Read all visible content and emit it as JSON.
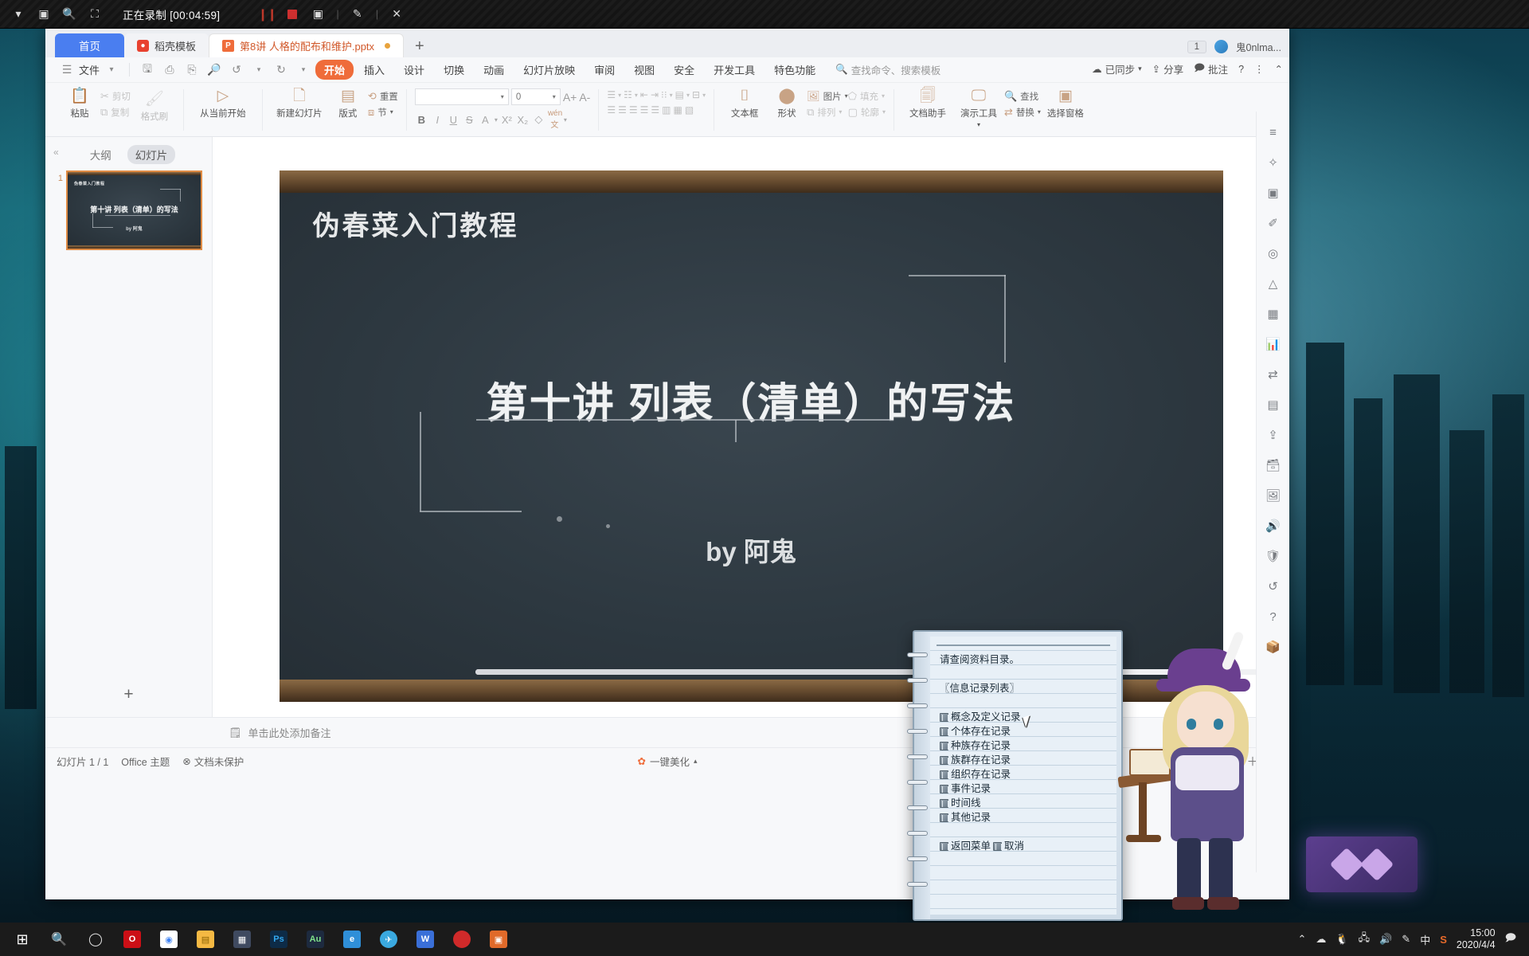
{
  "recording_bar": {
    "status_text": "正在录制 [00:04:59]",
    "icons": [
      "chevron-down-icon",
      "window-icon",
      "zoom-icon",
      "crop-icon"
    ],
    "actions": [
      "pause-icon",
      "stop-icon",
      "camera-icon",
      "pen-icon",
      "close-icon"
    ]
  },
  "window": {
    "tabs": [
      {
        "label": "首页",
        "kind": "home"
      },
      {
        "label": "稻壳模板",
        "kind": "template"
      },
      {
        "label": "第8讲 人格的配布和维护.pptx",
        "kind": "document",
        "modified": true
      }
    ],
    "new_tab_label": "+",
    "tab_count_badge": "1",
    "user_name": "鬼0nlma...",
    "window_controls": {
      "minimize": "—",
      "maximize": "□",
      "close": "×"
    }
  },
  "quickaccess": {
    "file_menu": "文件",
    "icons": [
      "save-icon",
      "print-icon",
      "export-pdf-icon",
      "print-preview-icon",
      "undo-icon",
      "redo-icon",
      "customize-icon"
    ]
  },
  "ribbon": {
    "tabs": [
      "开始",
      "插入",
      "设计",
      "切换",
      "动画",
      "幻灯片放映",
      "审阅",
      "视图",
      "安全",
      "开发工具",
      "特色功能"
    ],
    "selected_tab": "开始",
    "search_placeholder": "查找命令、搜索模板",
    "right_items": [
      {
        "label": "已同步",
        "icon": "cloud-sync-icon"
      },
      {
        "label": "分享",
        "icon": "share-icon"
      },
      {
        "label": "批注",
        "icon": "comment-icon"
      }
    ],
    "right_icons": [
      "help-icon",
      "more-icon",
      "collapse-ribbon-icon"
    ],
    "groups": {
      "clipboard": {
        "paste": "粘贴",
        "cut": "剪切",
        "copy": "复制",
        "format_painter": "格式刷"
      },
      "present": {
        "from_current": "从当前开始"
      },
      "slides": {
        "new_slide": "新建幻灯片",
        "layout": "版式",
        "section": "节",
        "reset": "重置"
      },
      "font": {
        "font_name": "",
        "font_size": "0",
        "grow": "A+",
        "shrink": "A-",
        "bold": "B",
        "italic": "I",
        "underline": "U",
        "strikethrough": "S",
        "font_color": "A",
        "superscript": "X²",
        "subscript": "X₂",
        "clear_format": "clear",
        "phonetic": "wén文"
      },
      "paragraph": {
        "bullets": "bullets-icon",
        "numbering": "numbering-icon",
        "decrease_indent": "decrease-indent-icon",
        "increase_indent": "increase-indent-icon",
        "line_spacing": "line-spacing-icon",
        "text_direction": "text-direction-icon",
        "align_text": "align-text-icon",
        "align_left": "align-left-icon",
        "align_center": "align-center-icon",
        "align_right": "align-right-icon",
        "justify": "justify-icon",
        "distributed": "distributed-icon",
        "columns": "columns-icon",
        "smartart": "smartart-icon"
      },
      "insert": {
        "text_box": "文本框",
        "shape": "形状",
        "picture": "图片",
        "fill": "填充",
        "arrange": "排列",
        "outline": "轮廓"
      },
      "tools": {
        "doc_assistant": "文档助手",
        "present_tools": "演示工具",
        "find": "查找",
        "replace": "替换",
        "select_pane": "选择窗格"
      }
    }
  },
  "slide_panel": {
    "collapse_icon": "collapse-left-icon",
    "tabs": [
      "大纲",
      "幻灯片"
    ],
    "selected_tab": "幻灯片",
    "slides": [
      {
        "number": "1",
        "header": "伪春菜入门教程",
        "title": "第十讲 列表（清单）的写法",
        "byline": "by 阿鬼"
      }
    ],
    "add_slide_label": "+"
  },
  "slide": {
    "header": "伪春菜入门教程",
    "title": "第十讲 列表（清单）的写法",
    "byline": "by 阿鬼"
  },
  "notes": {
    "placeholder": "单击此处添加备注",
    "icon": "notes-icon"
  },
  "status_bar": {
    "slide_count": "幻灯片 1 / 1",
    "theme": "Office 主题",
    "protection": "文档未保护",
    "beautify": "一键美化",
    "right_icons": [
      "add-icon",
      "fit-screen-icon"
    ]
  },
  "right_rail": {
    "icons": [
      "menu-icon",
      "star-icon",
      "image-frame-icon",
      "brush-icon",
      "target-icon",
      "shape-icon",
      "grid-icon",
      "chart-icon",
      "flow-icon",
      "layers-icon",
      "export-icon",
      "archive-icon",
      "picture-icon",
      "audio-icon",
      "shield-icon",
      "history-icon",
      "help-circle-icon",
      "package-icon"
    ]
  },
  "notepad_dialog": {
    "prompt": "请查阅资料目录。",
    "section_title": "〖信息记录列表〗",
    "items": [
      "概念及定义记录",
      "个体存在记录",
      "种族存在记录",
      "族群存在记录",
      "组织存在记录",
      "事件记录",
      "时间线",
      "其他记录"
    ],
    "footer_buttons": [
      "返回菜单",
      "取消"
    ]
  },
  "taskbar": {
    "start_icon": "windows-start-icon",
    "apps": [
      "search-icon",
      "cortana-icon",
      "opera-icon",
      "chrome-icon",
      "explorer-icon",
      "store-icon",
      "photoshop-icon",
      "audition-icon",
      "edge-icon",
      "telegram-icon",
      "wps-icon",
      "record-icon",
      "app-icon"
    ],
    "tray_icons": [
      "chevron-up-icon",
      "onedrive-icon",
      "qq-icon",
      "network-icon",
      "volume-icon",
      "pen-tray-icon"
    ],
    "ime_label": "中",
    "sogou_icon": "sogou-icon",
    "clock_time": "15:00",
    "clock_date": "2020/4/4",
    "action_center_icon": "action-center-icon"
  },
  "colors": {
    "accent_orange": "#ef6c3a",
    "tab_blue": "#4a7ef0",
    "thumb_border": "#e08c45",
    "recording_red": "#cf3030"
  }
}
